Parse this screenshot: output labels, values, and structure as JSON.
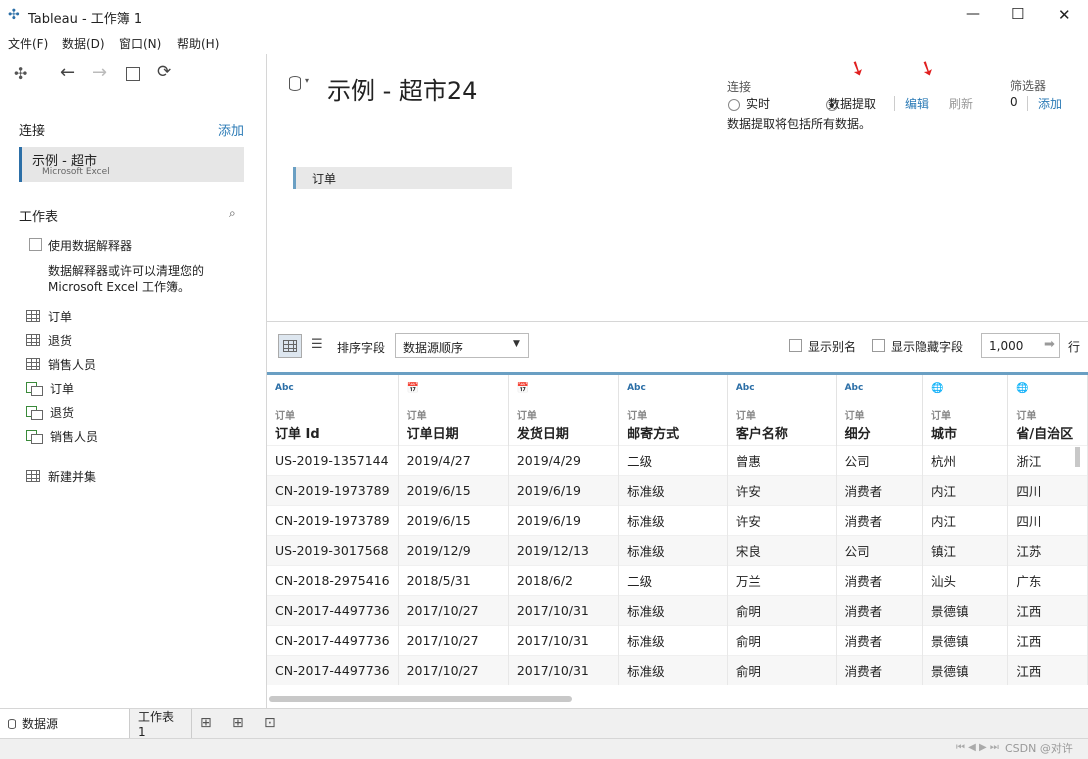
{
  "window": {
    "title": "Tableau - 工作簿 1",
    "minimize": "—",
    "maximize": "☐",
    "close": "✕"
  },
  "menu": [
    "文件(F)",
    "数据(D)",
    "窗口(N)",
    "帮助(H)"
  ],
  "left": {
    "connections_label": "连接",
    "add_label": "添加",
    "connection": {
      "name": "示例 - 超市",
      "type": "Microsoft Excel"
    },
    "sheets_label": "工作表",
    "interpreter_label": "使用数据解释器",
    "interpreter_desc_1": "数据解释器或许可以清理您的",
    "interpreter_desc_2": "Microsoft Excel 工作簿。",
    "sheets": [
      {
        "label": "订单",
        "icon": "table-icon"
      },
      {
        "label": "退货",
        "icon": "table-icon"
      },
      {
        "label": "销售人员",
        "icon": "table-icon"
      },
      {
        "label": "订单",
        "icon": "named-range-icon"
      },
      {
        "label": "退货",
        "icon": "named-range-icon"
      },
      {
        "label": "销售人员",
        "icon": "named-range-icon"
      }
    ],
    "new_union": "新建并集"
  },
  "datasource": {
    "title": "示例 - 超市24",
    "connection_label": "连接",
    "live_label": "实时",
    "extract_label": "数据提取",
    "edit_label": "编辑",
    "refresh_label": "刷新",
    "extract_note": "数据提取将包括所有数据。",
    "filters_label": "筛选器",
    "filters_count": "0",
    "filters_add": "添加",
    "canvas_table": "订单"
  },
  "gridbar": {
    "sort_label": "排序字段",
    "sort_value": "数据源顺序",
    "show_alias": "显示别名",
    "show_hidden": "显示隐藏字段",
    "rows_value": "1,000",
    "rows_label": "行"
  },
  "grid": {
    "columns": [
      {
        "type": "Abc",
        "source": "订单",
        "name": "订单 Id"
      },
      {
        "type": "date",
        "source": "订单",
        "name": "订单日期"
      },
      {
        "type": "date",
        "source": "订单",
        "name": "发货日期"
      },
      {
        "type": "Abc",
        "source": "订单",
        "name": "邮寄方式"
      },
      {
        "type": "Abc",
        "source": "订单",
        "name": "客户名称"
      },
      {
        "type": "Abc",
        "source": "订单",
        "name": "细分"
      },
      {
        "type": "geo",
        "source": "订单",
        "name": "城市"
      },
      {
        "type": "geo",
        "source": "订单",
        "name": "省/自治区"
      }
    ],
    "rows": [
      [
        "US-2019-1357144",
        "2019/4/27",
        "2019/4/29",
        "二级",
        "曾惠",
        "公司",
        "杭州",
        "浙江"
      ],
      [
        "CN-2019-1973789",
        "2019/6/15",
        "2019/6/19",
        "标准级",
        "许安",
        "消费者",
        "内江",
        "四川"
      ],
      [
        "CN-2019-1973789",
        "2019/6/15",
        "2019/6/19",
        "标准级",
        "许安",
        "消费者",
        "内江",
        "四川"
      ],
      [
        "US-2019-3017568",
        "2019/12/9",
        "2019/12/13",
        "标准级",
        "宋良",
        "公司",
        "镇江",
        "江苏"
      ],
      [
        "CN-2018-2975416",
        "2018/5/31",
        "2018/6/2",
        "二级",
        "万兰",
        "消费者",
        "汕头",
        "广东"
      ],
      [
        "CN-2017-4497736",
        "2017/10/27",
        "2017/10/31",
        "标准级",
        "俞明",
        "消费者",
        "景德镇",
        "江西"
      ],
      [
        "CN-2017-4497736",
        "2017/10/27",
        "2017/10/31",
        "标准级",
        "俞明",
        "消费者",
        "景德镇",
        "江西"
      ],
      [
        "CN-2017-4497736",
        "2017/10/27",
        "2017/10/31",
        "标准级",
        "俞明",
        "消费者",
        "景德镇",
        "江西"
      ]
    ]
  },
  "tabs": {
    "datasource": "数据源",
    "sheet1": "工作表 1"
  },
  "watermark": "CSDN @对许"
}
